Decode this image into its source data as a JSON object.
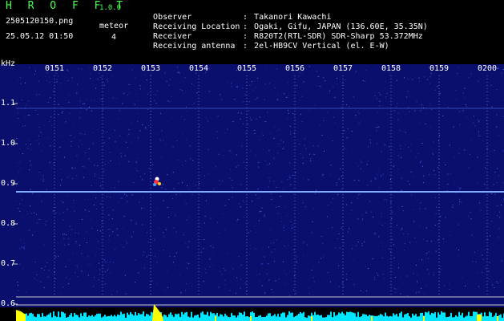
{
  "header": {
    "app_title": "H R O F F T",
    "app_version": "1.0.0",
    "filename": "2505120150.png",
    "datetime": "25.05.12 01:50",
    "meteor_label": "meteor",
    "meteor_count": "4"
  },
  "info": [
    {
      "label": "Observer",
      "sep": ":",
      "value": "Takanori Kawachi"
    },
    {
      "label": "Receiving Location",
      "sep": ":",
      "value": "Ogaki, Gifu, JAPAN (136.60E, 35.35N)"
    },
    {
      "label": "Receiver",
      "sep": ":",
      "value": "R820T2(RTL-SDR) SDR-Sharp 53.372MHz"
    },
    {
      "label": "Receiving antenna",
      "sep": ":",
      "value": "2el-HB9CV Vertical (el. E-W)"
    }
  ],
  "axis": {
    "unit": "kHz",
    "time_ticks": [
      "0151",
      "0152",
      "0153",
      "0154",
      "0155",
      "0156",
      "0157",
      "0158",
      "0159",
      "0200"
    ],
    "freq_ticks": [
      "1.1",
      "1.0",
      "0.9",
      "0.8",
      "0.7",
      "0.6"
    ]
  },
  "colors": {
    "background": "#000000",
    "spectrogram_bg": "#0a0f6e",
    "signal_line": "#7fa8ff",
    "activity": "#00e5ff",
    "meteor_marker": "#ffff00",
    "title_green": "#4dff4d"
  }
}
